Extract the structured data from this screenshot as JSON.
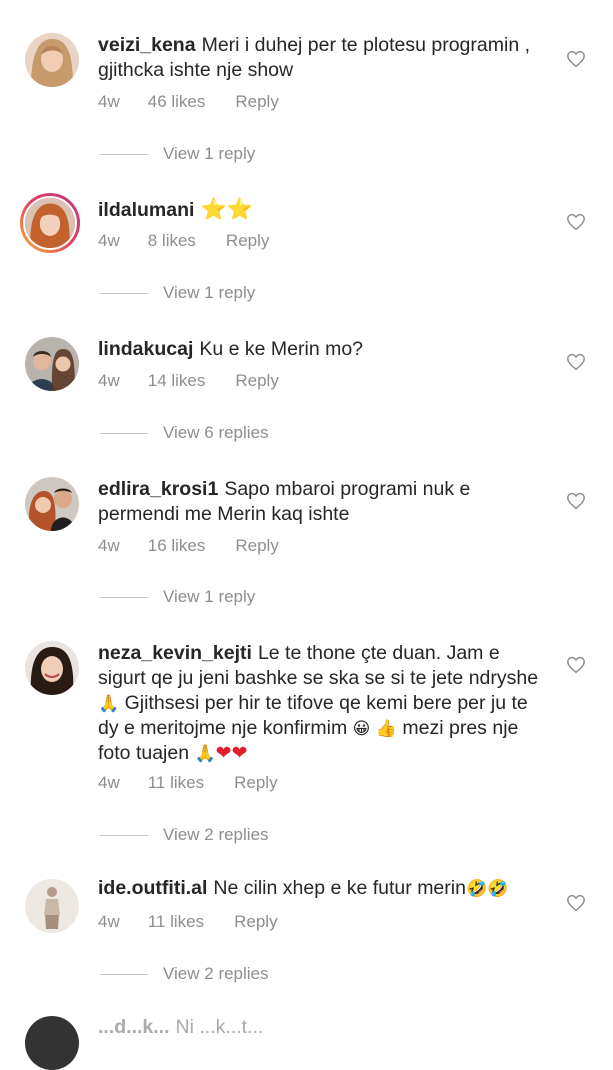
{
  "comments": [
    {
      "username": "veizi_kena",
      "body": "Meri i duhej per te plotesu programin , gjithcka ishte nje show",
      "time": "4w",
      "likes": "46 likes",
      "reply": "Reply",
      "view_replies": "View 1 reply"
    },
    {
      "username": "ildalumani",
      "body": "",
      "emoji": "⭐⭐",
      "time": "4w",
      "likes": "8 likes",
      "reply": "Reply",
      "view_replies": "View 1 reply"
    },
    {
      "username": "lindakucaj",
      "body": "Ku e ke Merin mo?",
      "time": "4w",
      "likes": "14 likes",
      "reply": "Reply",
      "view_replies": "View 6 replies"
    },
    {
      "username": "edlira_krosi1",
      "body": "Sapo mbaroi programi nuk e permendi me Merin kaq ishte",
      "time": "4w",
      "likes": "16 likes",
      "reply": "Reply",
      "view_replies": "View 1 reply"
    },
    {
      "username": "neza_kevin_kejti",
      "body_part1": "Le te thone çte duan.  Jam e sigurt qe ju jeni bashke se ska se si te jete ndryshe",
      "body_part2": "Gjithsesi per hir te tifove qe kemi bere per ju te dy e meritojme nje konfirmim",
      "body_part3": "mezi pres nje foto tuajen",
      "emoji_pray": "🙏",
      "emoji_smile": "😀",
      "emoji_thumb": "👍",
      "emoji_hearts": "❤❤",
      "time": "4w",
      "likes": "11 likes",
      "reply": "Reply",
      "view_replies": "View 2 replies"
    },
    {
      "username": "ide.outfiti.al",
      "body": "Ne cilin xhep e ke futur merin",
      "emoji": "🤣🤣",
      "time": "4w",
      "likes": "11 likes",
      "reply": "Reply",
      "view_replies": "View 2 replies"
    }
  ],
  "partial_comment": {
    "username": "...d...k...",
    "body": "Ni ...k...t..."
  },
  "icons": {
    "like": "heart-outline-icon"
  },
  "colors": {
    "text": "#262626",
    "meta": "#8e8e8e",
    "story_ring": "#e4405f"
  }
}
